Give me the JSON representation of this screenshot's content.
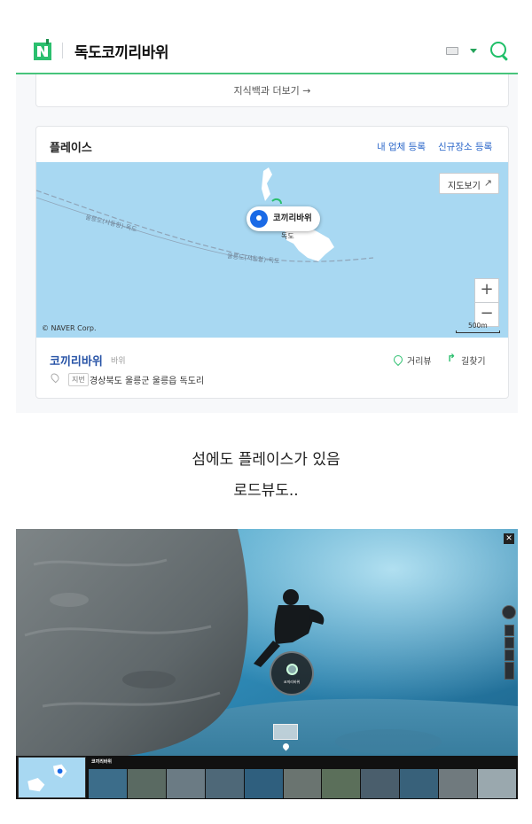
{
  "header": {
    "title": "독도코끼리바위"
  },
  "knowledge": {
    "more_link": "지식백과 더보기 →"
  },
  "place": {
    "section_title": "플레이스",
    "link_register_business": "내 업체 등록",
    "link_register_place": "신규장소 등록",
    "map": {
      "view_button": "지도보기",
      "marker_label": "코끼리바위",
      "island_label": "독도",
      "route_label_1": "울릉도(사동항)-독도",
      "route_label_2": "울릉도(저동항)-독도",
      "copyright": "© NAVER Corp.",
      "scale": "500m",
      "zoom_in": "+",
      "zoom_out": "−"
    },
    "result": {
      "name": "코끼리바위",
      "category": "바위",
      "jibun_tag": "지번",
      "address": "경상북도 울릉군 울릉읍 독도리",
      "distance_view": "거리뷰",
      "directions": "길찾기"
    }
  },
  "captions": {
    "line1": "섬에도 플레이스가 있음",
    "line2": "로드뷰도.."
  },
  "roadview": {
    "close": "✕",
    "strip_title": "코끼리바위",
    "colors": {
      "water": "#2d87b3",
      "rock": "#6d7478"
    }
  },
  "colors": {
    "accent_green": "#47c47b",
    "link_blue": "#2a66c9",
    "map_water": "#a8d8f2",
    "marker_blue": "#1a6ae6"
  }
}
